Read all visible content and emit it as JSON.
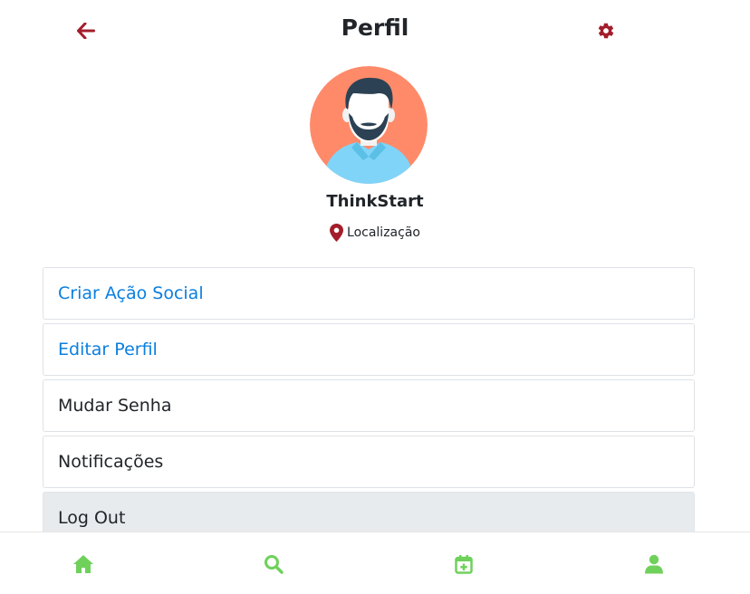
{
  "header": {
    "title": "Perfil",
    "back_icon": "arrow-left-icon",
    "settings_icon": "gear-icon",
    "icon_color": "#a31d2b"
  },
  "profile": {
    "avatar_icon": "user-avatar-bearded-man",
    "name": "ThinkStart",
    "location_icon": "map-pin-icon",
    "location_label": "Localização"
  },
  "menu": {
    "items": [
      {
        "label": "Criar Ação Social",
        "style": "link"
      },
      {
        "label": "Editar Perfil",
        "style": "link"
      },
      {
        "label": "Mudar Senha",
        "style": "default"
      },
      {
        "label": "Notificações",
        "style": "default"
      },
      {
        "label": "Log Out",
        "style": "active"
      }
    ]
  },
  "bottom_nav": {
    "accent_color": "#6fd15b",
    "items": [
      {
        "icon": "home-icon"
      },
      {
        "icon": "search-icon"
      },
      {
        "icon": "calendar-plus-icon"
      },
      {
        "icon": "user-icon"
      }
    ]
  }
}
